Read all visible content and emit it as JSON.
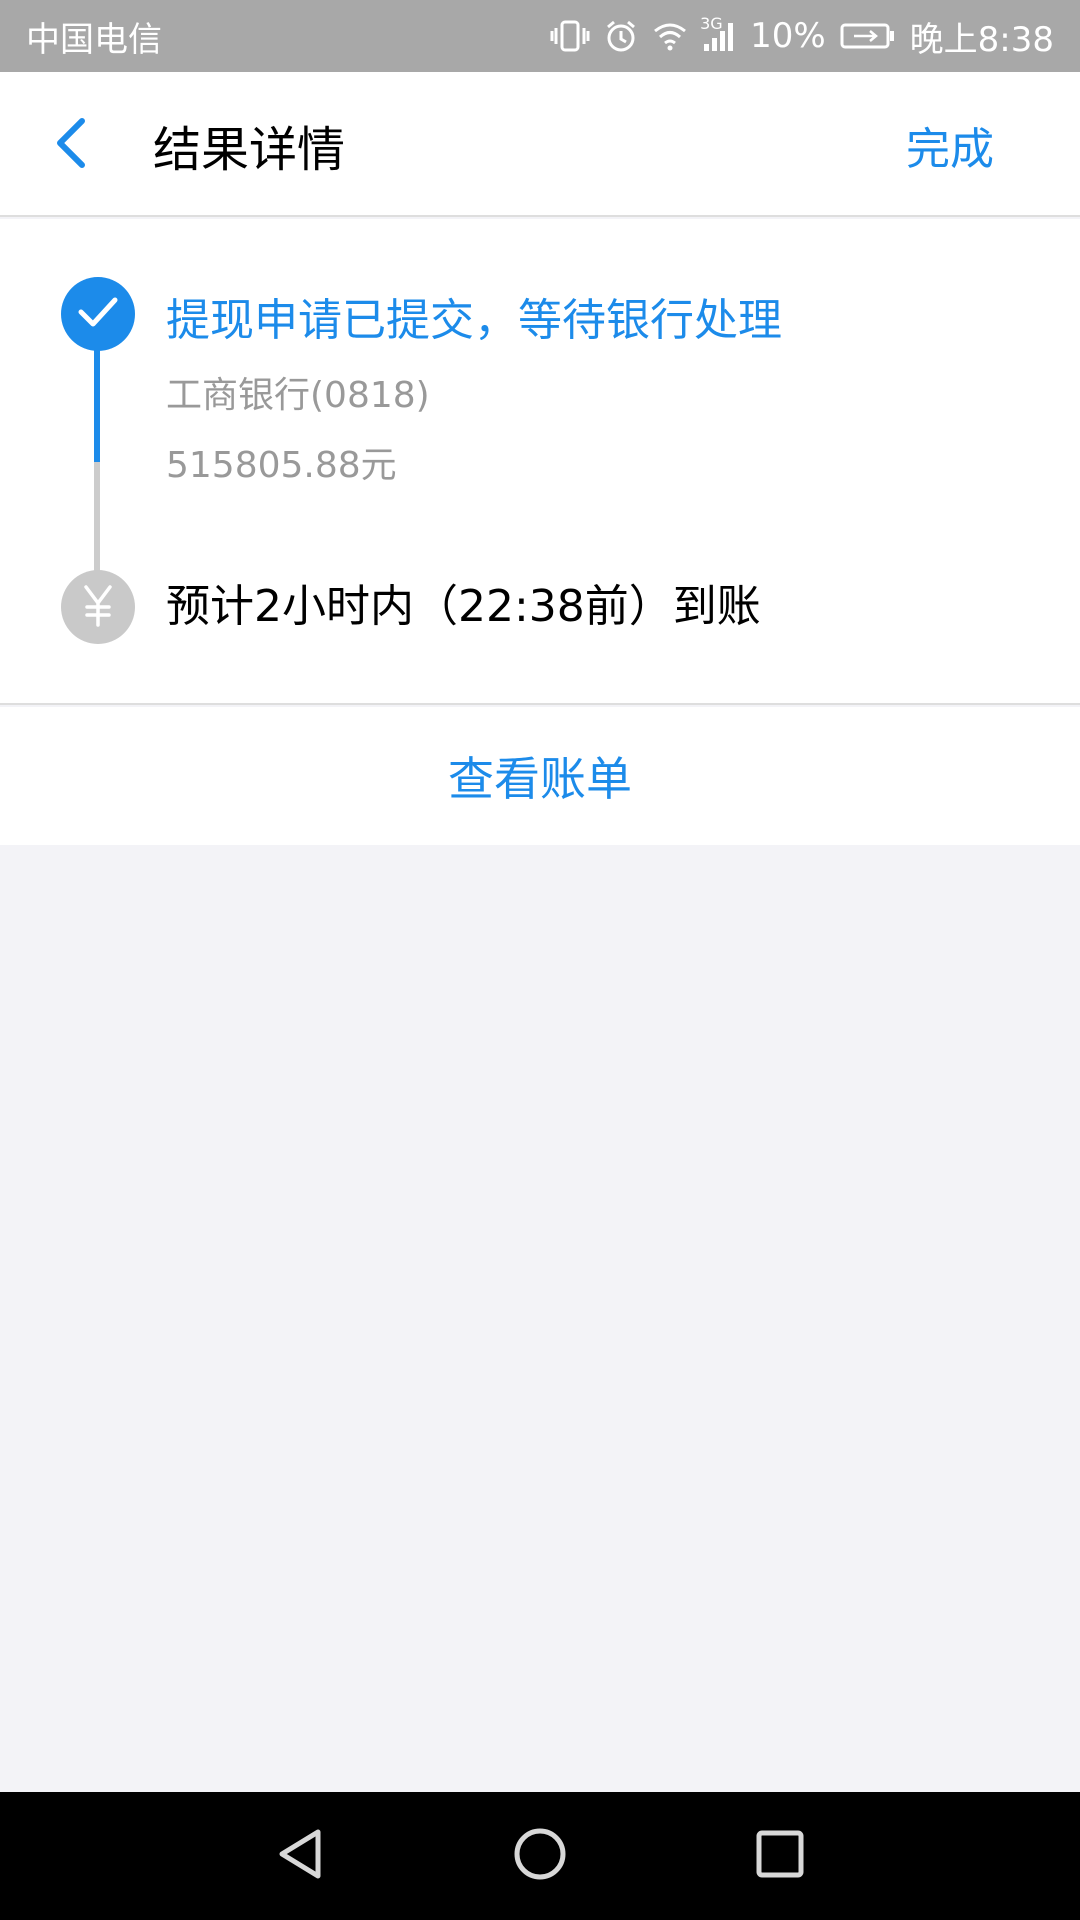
{
  "status_bar": {
    "carrier": "中国电信",
    "network": "3G",
    "battery": "10%",
    "time": "晚上8:38",
    "icons": [
      "vibrate-icon",
      "alarm-icon",
      "wifi-icon",
      "signal-icon",
      "battery-icon"
    ]
  },
  "header": {
    "title": "结果详情",
    "done_label": "完成",
    "back_icon": "chevron-left-icon"
  },
  "progress": {
    "step1": {
      "title": "提现申请已提交，等待银行处理",
      "bank": "工商银行(0818)",
      "amount": "515805.88元",
      "icon": "checkmark-icon"
    },
    "step2": {
      "title": "预计2小时内（22:38前）到账",
      "icon": "yen-icon"
    }
  },
  "actions": {
    "view_bill_label": "查看账单"
  },
  "nav": {
    "icons": [
      "back-triangle-icon",
      "home-circle-icon",
      "recents-square-icon"
    ]
  },
  "colors": {
    "accent": "#1c8bea",
    "status_bar": "#a8a8a8",
    "page_background": "#f3f3f7",
    "pending": "#c9c9c9"
  }
}
